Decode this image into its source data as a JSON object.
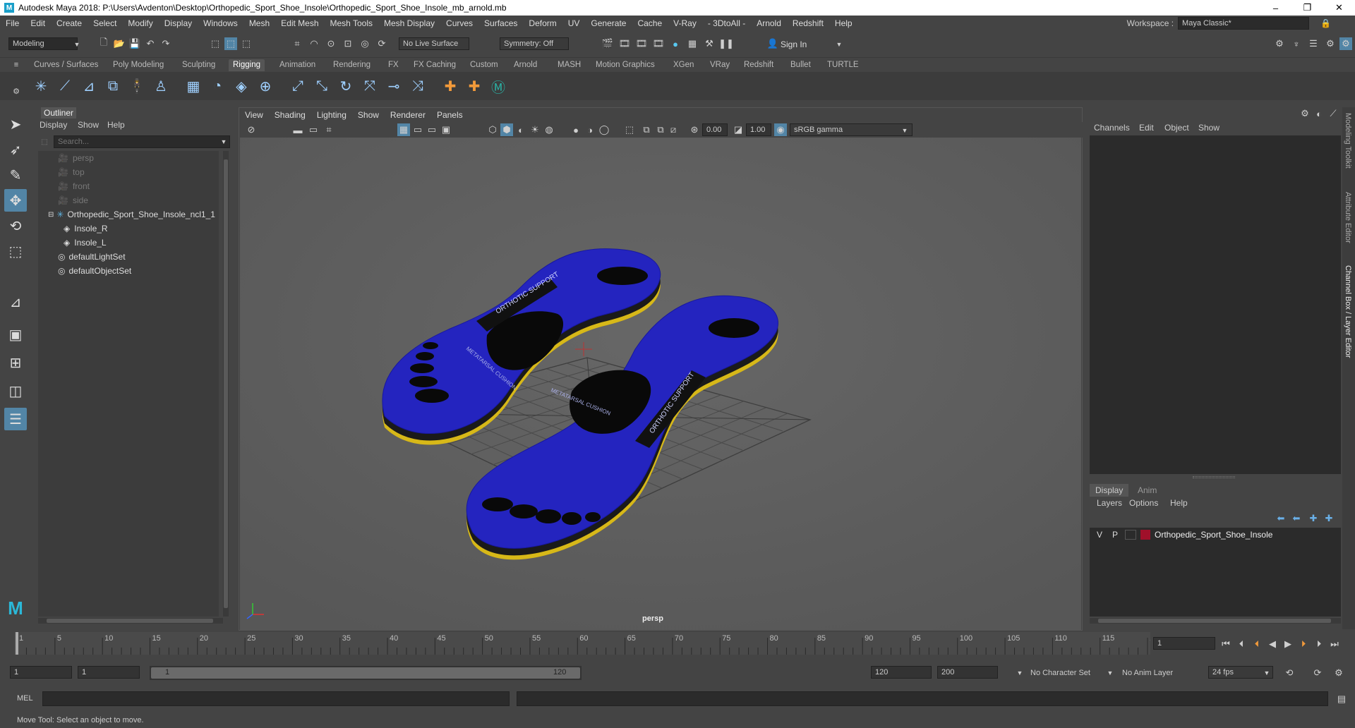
{
  "window": {
    "title": "Autodesk Maya 2018: P:\\Users\\Avdenton\\Desktop\\Orthopedic_Sport_Shoe_Insole\\Orthopedic_Sport_Shoe_Insole_mb_arnold.mb",
    "logo": "M",
    "minimize": "–",
    "maximize": "❐",
    "close": "✕"
  },
  "menu": [
    "File",
    "Edit",
    "Create",
    "Select",
    "Modify",
    "Display",
    "Windows",
    "Mesh",
    "Edit Mesh",
    "Mesh Tools",
    "Mesh Display",
    "Curves",
    "Surfaces",
    "Deform",
    "UV",
    "Generate",
    "Cache",
    "V-Ray",
    "- 3DtoAll -",
    "Arnold",
    "Redshift",
    "Help"
  ],
  "workspace": {
    "label": "Workspace :",
    "value": "Maya Classic*"
  },
  "status": {
    "mode": "Modeling",
    "live_surface": "No Live Surface",
    "symmetry": "Symmetry: Off",
    "sign_in": "Sign In"
  },
  "shelf_tabs": [
    "Curves / Surfaces",
    "Poly Modeling",
    "Sculpting",
    "Rigging",
    "Animation",
    "Rendering",
    "FX",
    "FX Caching",
    "Custom",
    "Arnold",
    "MASH",
    "Motion Graphics",
    "XGen",
    "VRay",
    "Redshift",
    "Bullet",
    "TURTLE"
  ],
  "active_shelf": "Rigging",
  "outliner": {
    "title": "Outliner",
    "menu": [
      "Display",
      "Show",
      "Help"
    ],
    "search_placeholder": "Search...",
    "items": [
      {
        "label": "persp",
        "dim": true,
        "indent": 0
      },
      {
        "label": "top",
        "dim": true,
        "indent": 0
      },
      {
        "label": "front",
        "dim": true,
        "indent": 0
      },
      {
        "label": "side",
        "dim": true,
        "indent": 0
      },
      {
        "label": "Orthopedic_Sport_Shoe_Insole_ncl1_1",
        "dim": false,
        "indent": 0
      },
      {
        "label": "Insole_R",
        "dim": false,
        "indent": 1
      },
      {
        "label": "Insole_L",
        "dim": false,
        "indent": 1
      },
      {
        "label": "defaultLightSet",
        "dim": false,
        "indent": 0
      },
      {
        "label": "defaultObjectSet",
        "dim": false,
        "indent": 0
      }
    ]
  },
  "viewport": {
    "menu": [
      "View",
      "Shading",
      "Lighting",
      "Show",
      "Renderer",
      "Panels"
    ],
    "exposure": "0.00",
    "gamma": "1.00",
    "color_space": "sRGB gamma",
    "camera_label": "persp",
    "insole_text_1": "ORTHOTIC SUPPORT",
    "insole_text_2": "METATARSAL CUSHION"
  },
  "channel_box": {
    "menu": [
      "Channels",
      "Edit",
      "Object",
      "Show"
    ]
  },
  "layer_editor": {
    "tabs": [
      "Display",
      "Anim"
    ],
    "menu": [
      "Layers",
      "Options",
      "Help"
    ],
    "layer": {
      "v": "V",
      "p": "P",
      "name": "Orthopedic_Sport_Shoe_Insole",
      "color": "#a0102a"
    }
  },
  "side_tabs": [
    "Modeling Toolkit",
    "Attribute Editor",
    "Channel Box / Layer Editor"
  ],
  "timeline": {
    "ticks": [
      "1",
      "5",
      "10",
      "15",
      "20",
      "25",
      "30",
      "35",
      "40",
      "45",
      "50",
      "55",
      "60",
      "65",
      "70",
      "75",
      "80",
      "85",
      "90",
      "95",
      "100",
      "105",
      "110",
      "115",
      "120"
    ],
    "current_frame": "1"
  },
  "range": {
    "start": "1",
    "playback_start": "1",
    "slider_start": "1",
    "slider_end": "120",
    "playback_end": "120",
    "end": "200",
    "character_set": "No Character Set",
    "anim_layer": "No Anim Layer",
    "fps": "24 fps"
  },
  "cmdline": {
    "label": "MEL"
  },
  "help_line": "Move Tool: Select an object to move.",
  "colors": {
    "accent": "#5285a6",
    "insole_top": "#2222b8",
    "insole_edge": "#e8c21a"
  }
}
